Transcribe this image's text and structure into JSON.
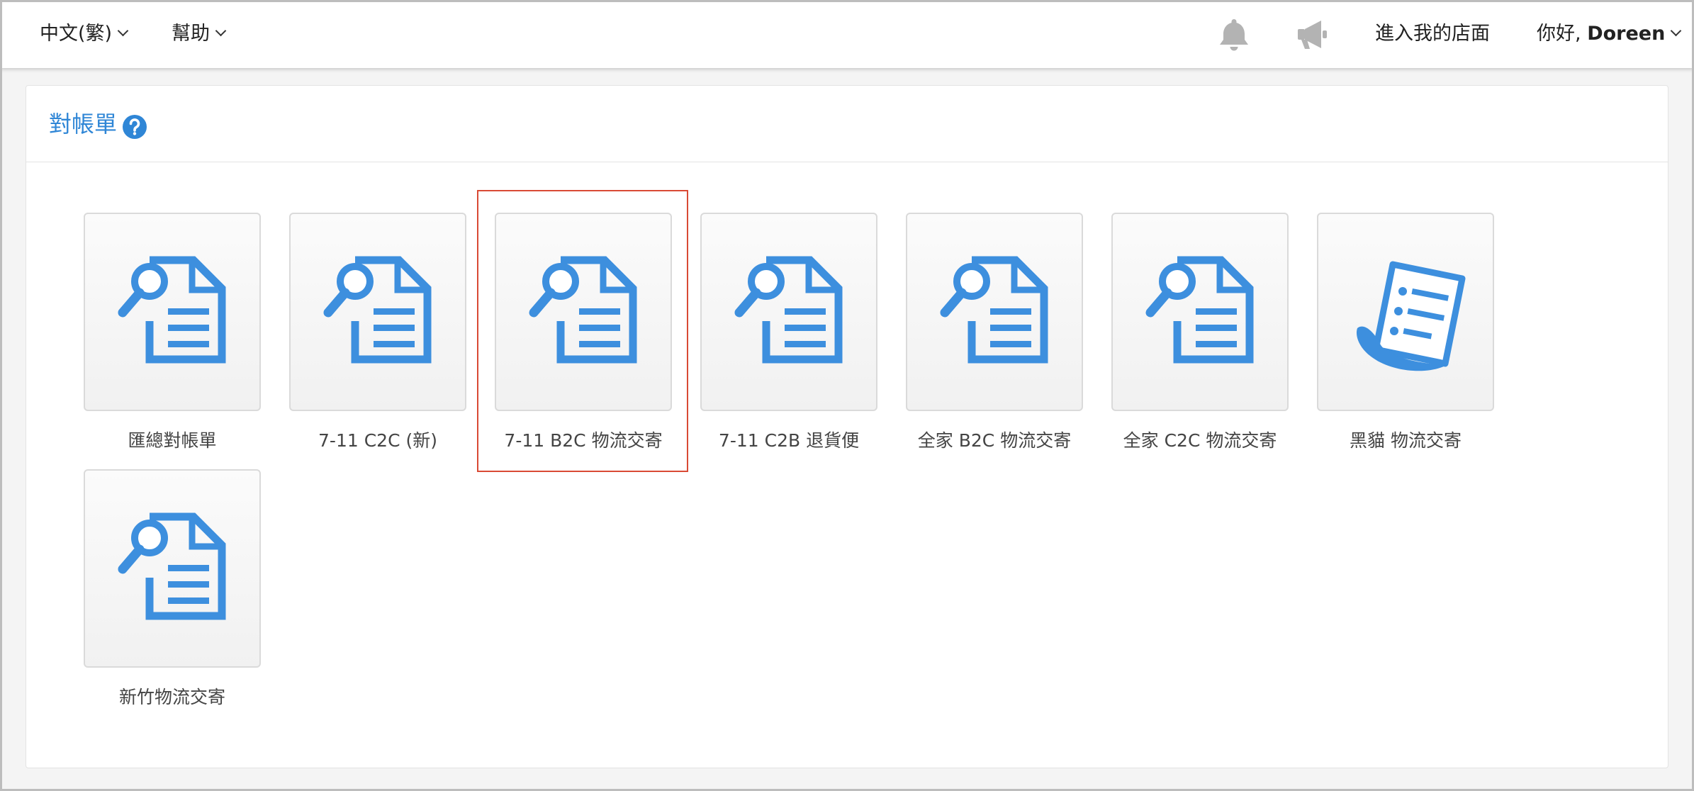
{
  "nav": {
    "language": "中文(繁)",
    "help": "幫助",
    "enter_store": "進入我的店面",
    "greeting": "你好,",
    "user_name": "Doreen",
    "bell_icon": "bell-icon",
    "announce_icon": "megaphone-icon"
  },
  "panel": {
    "title": "對帳單",
    "help_icon": "question-circle-icon"
  },
  "tiles": [
    {
      "label": "匯總對帳單",
      "icon": "document-search-icon"
    },
    {
      "label": "7-11 C2C (新)",
      "icon": "document-search-icon"
    },
    {
      "label": "7-11 B2C 物流交寄",
      "icon": "document-search-icon",
      "highlighted": true
    },
    {
      "label": "7-11 C2B 退貨便",
      "icon": "document-search-icon"
    },
    {
      "label": "全家 B2C 物流交寄",
      "icon": "document-search-icon"
    },
    {
      "label": "全家 C2C 物流交寄",
      "icon": "document-search-icon"
    },
    {
      "label": "黑貓 物流交寄",
      "icon": "receipt-scroll-icon"
    },
    {
      "label": "新竹物流交寄",
      "icon": "document-search-icon"
    }
  ],
  "colors": {
    "accent": "#2f86d6",
    "icon_blue": "#3d8fde",
    "highlight_border": "#d94a35"
  }
}
